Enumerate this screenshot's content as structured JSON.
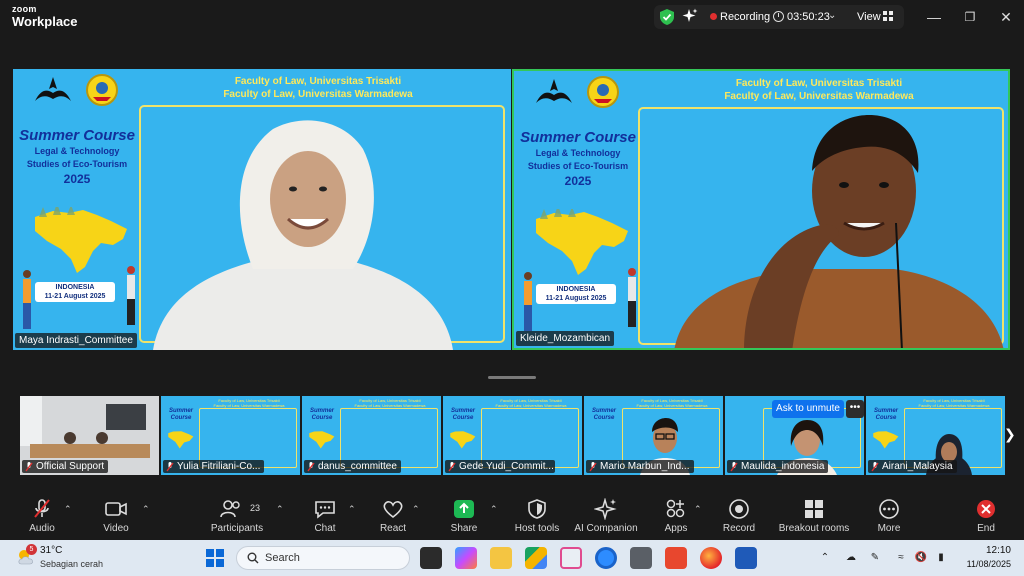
{
  "app": {
    "brand_top": "zoom",
    "brand_bottom": "Workplace"
  },
  "titlebar": {
    "recording_label": "Recording",
    "timer": "03:50:23",
    "view_label": "View",
    "colors": {
      "security": "#2ec04f",
      "recording": "#e02f2f"
    }
  },
  "banner": {
    "faculty_line1": "Faculty of Law, Universitas Trisakti",
    "faculty_line2": "Faculty of Law, Universitas Warmadewa",
    "title": "Summer Course",
    "subtitle1": "Legal & Technology",
    "subtitle2": "Studies of Eco-Tourism",
    "year": "2025",
    "country": "INDONESIA",
    "dates": "11-21 August 2025",
    "colors": {
      "bg": "#36b4ee",
      "accent": "#ffe95a",
      "title": "#12309b"
    }
  },
  "main_tiles": [
    {
      "name": "Maya Indrasti_Committee"
    },
    {
      "name": "Kleide_Mozambican"
    }
  ],
  "filmstrip": {
    "ask_to_unmute": "Ask to unmute",
    "more": "•••",
    "tiles": [
      {
        "name": "Official Support"
      },
      {
        "name": "Yulia Fitriliani-Co..."
      },
      {
        "name": "danus_committee"
      },
      {
        "name": "Gede Yudi_Commit..."
      },
      {
        "name": "Mario Marbun_Ind..."
      },
      {
        "name": "Maulida_indonesia"
      },
      {
        "name": "Airani_Malaysia"
      }
    ]
  },
  "toolbar": {
    "participants_count": "23",
    "items": [
      {
        "label": "Audio",
        "icon": "mic-muted-icon"
      },
      {
        "label": "Video",
        "icon": "camera-icon"
      },
      {
        "label": "Participants",
        "icon": "people-icon"
      },
      {
        "label": "Chat",
        "icon": "chat-icon"
      },
      {
        "label": "React",
        "icon": "heart-icon"
      },
      {
        "label": "Share",
        "icon": "share-up-arrow-icon"
      },
      {
        "label": "Host tools",
        "icon": "shield-icon"
      },
      {
        "label": "AI Companion",
        "icon": "sparkle-icon"
      },
      {
        "label": "Apps",
        "icon": "apps-icon"
      },
      {
        "label": "Record",
        "icon": "record-icon"
      },
      {
        "label": "Breakout rooms",
        "icon": "grid-icon"
      },
      {
        "label": "More",
        "icon": "ellipsis-icon"
      },
      {
        "label": "End",
        "icon": "end-icon"
      }
    ],
    "colors": {
      "share": "#1db954",
      "end": "#e02f2f"
    }
  },
  "taskbar": {
    "weather_badge": "5",
    "temperature": "31°C",
    "condition": "Sebagian cerah",
    "search_placeholder": "Search",
    "time": "12:10",
    "date": "11/08/2025"
  }
}
